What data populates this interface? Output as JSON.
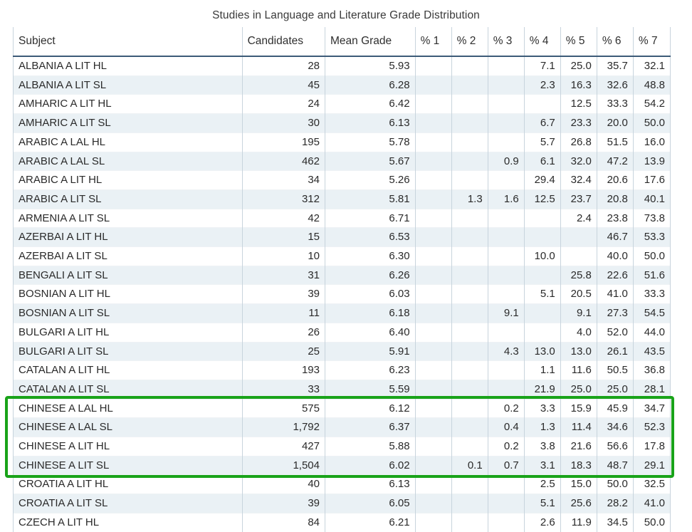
{
  "title": "Studies in Language and Literature Grade Distribution",
  "table": {
    "columns": [
      {
        "key": "subject",
        "label": "Subject"
      },
      {
        "key": "candidates",
        "label": "Candidates"
      },
      {
        "key": "mean_grade",
        "label": "Mean Grade"
      },
      {
        "key": "pct1",
        "label": "% 1"
      },
      {
        "key": "pct2",
        "label": "% 2"
      },
      {
        "key": "pct3",
        "label": "% 3"
      },
      {
        "key": "pct4",
        "label": "% 4"
      },
      {
        "key": "pct5",
        "label": "% 5"
      },
      {
        "key": "pct6",
        "label": "% 6"
      },
      {
        "key": "pct7",
        "label": "% 7"
      }
    ],
    "rows": [
      {
        "subject": "ALBANIA A LIT HL",
        "candidates": "28",
        "mean_grade": "5.93",
        "pct1": "",
        "pct2": "",
        "pct3": "",
        "pct4": "7.1",
        "pct5": "25.0",
        "pct6": "35.7",
        "pct7": "32.1"
      },
      {
        "subject": "ALBANIA A LIT SL",
        "candidates": "45",
        "mean_grade": "6.28",
        "pct1": "",
        "pct2": "",
        "pct3": "",
        "pct4": "2.3",
        "pct5": "16.3",
        "pct6": "32.6",
        "pct7": "48.8"
      },
      {
        "subject": "AMHARIC A LIT HL",
        "candidates": "24",
        "mean_grade": "6.42",
        "pct1": "",
        "pct2": "",
        "pct3": "",
        "pct4": "",
        "pct5": "12.5",
        "pct6": "33.3",
        "pct7": "54.2"
      },
      {
        "subject": "AMHARIC A LIT SL",
        "candidates": "30",
        "mean_grade": "6.13",
        "pct1": "",
        "pct2": "",
        "pct3": "",
        "pct4": "6.7",
        "pct5": "23.3",
        "pct6": "20.0",
        "pct7": "50.0"
      },
      {
        "subject": "ARABIC A LAL HL",
        "candidates": "195",
        "mean_grade": "5.78",
        "pct1": "",
        "pct2": "",
        "pct3": "",
        "pct4": "5.7",
        "pct5": "26.8",
        "pct6": "51.5",
        "pct7": "16.0"
      },
      {
        "subject": "ARABIC A LAL SL",
        "candidates": "462",
        "mean_grade": "5.67",
        "pct1": "",
        "pct2": "",
        "pct3": "0.9",
        "pct4": "6.1",
        "pct5": "32.0",
        "pct6": "47.2",
        "pct7": "13.9"
      },
      {
        "subject": "ARABIC A LIT HL",
        "candidates": "34",
        "mean_grade": "5.26",
        "pct1": "",
        "pct2": "",
        "pct3": "",
        "pct4": "29.4",
        "pct5": "32.4",
        "pct6": "20.6",
        "pct7": "17.6"
      },
      {
        "subject": "ARABIC A LIT SL",
        "candidates": "312",
        "mean_grade": "5.81",
        "pct1": "",
        "pct2": "1.3",
        "pct3": "1.6",
        "pct4": "12.5",
        "pct5": "23.7",
        "pct6": "20.8",
        "pct7": "40.1"
      },
      {
        "subject": "ARMENIA A LIT SL",
        "candidates": "42",
        "mean_grade": "6.71",
        "pct1": "",
        "pct2": "",
        "pct3": "",
        "pct4": "",
        "pct5": "2.4",
        "pct6": "23.8",
        "pct7": "73.8"
      },
      {
        "subject": "AZERBAI A LIT HL",
        "candidates": "15",
        "mean_grade": "6.53",
        "pct1": "",
        "pct2": "",
        "pct3": "",
        "pct4": "",
        "pct5": "",
        "pct6": "46.7",
        "pct7": "53.3"
      },
      {
        "subject": "AZERBAI A LIT SL",
        "candidates": "10",
        "mean_grade": "6.30",
        "pct1": "",
        "pct2": "",
        "pct3": "",
        "pct4": "10.0",
        "pct5": "",
        "pct6": "40.0",
        "pct7": "50.0"
      },
      {
        "subject": "BENGALI A LIT SL",
        "candidates": "31",
        "mean_grade": "6.26",
        "pct1": "",
        "pct2": "",
        "pct3": "",
        "pct4": "",
        "pct5": "25.8",
        "pct6": "22.6",
        "pct7": "51.6"
      },
      {
        "subject": "BOSNIAN A LIT HL",
        "candidates": "39",
        "mean_grade": "6.03",
        "pct1": "",
        "pct2": "",
        "pct3": "",
        "pct4": "5.1",
        "pct5": "20.5",
        "pct6": "41.0",
        "pct7": "33.3"
      },
      {
        "subject": "BOSNIAN A LIT SL",
        "candidates": "11",
        "mean_grade": "6.18",
        "pct1": "",
        "pct2": "",
        "pct3": "9.1",
        "pct4": "",
        "pct5": "9.1",
        "pct6": "27.3",
        "pct7": "54.5"
      },
      {
        "subject": "BULGARI A LIT HL",
        "candidates": "26",
        "mean_grade": "6.40",
        "pct1": "",
        "pct2": "",
        "pct3": "",
        "pct4": "",
        "pct5": "4.0",
        "pct6": "52.0",
        "pct7": "44.0"
      },
      {
        "subject": "BULGARI A LIT SL",
        "candidates": "25",
        "mean_grade": "5.91",
        "pct1": "",
        "pct2": "",
        "pct3": "4.3",
        "pct4": "13.0",
        "pct5": "13.0",
        "pct6": "26.1",
        "pct7": "43.5"
      },
      {
        "subject": "CATALAN A LIT HL",
        "candidates": "193",
        "mean_grade": "6.23",
        "pct1": "",
        "pct2": "",
        "pct3": "",
        "pct4": "1.1",
        "pct5": "11.6",
        "pct6": "50.5",
        "pct7": "36.8"
      },
      {
        "subject": "CATALAN A LIT SL",
        "candidates": "33",
        "mean_grade": "5.59",
        "pct1": "",
        "pct2": "",
        "pct3": "",
        "pct4": "21.9",
        "pct5": "25.0",
        "pct6": "25.0",
        "pct7": "28.1"
      },
      {
        "subject": "CHINESE A LAL HL",
        "candidates": "575",
        "mean_grade": "6.12",
        "pct1": "",
        "pct2": "",
        "pct3": "0.2",
        "pct4": "3.3",
        "pct5": "15.9",
        "pct6": "45.9",
        "pct7": "34.7"
      },
      {
        "subject": "CHINESE A LAL SL",
        "candidates": "1,792",
        "mean_grade": "6.37",
        "pct1": "",
        "pct2": "",
        "pct3": "0.4",
        "pct4": "1.3",
        "pct5": "11.4",
        "pct6": "34.6",
        "pct7": "52.3"
      },
      {
        "subject": "CHINESE A LIT HL",
        "candidates": "427",
        "mean_grade": "5.88",
        "pct1": "",
        "pct2": "",
        "pct3": "0.2",
        "pct4": "3.8",
        "pct5": "21.6",
        "pct6": "56.6",
        "pct7": "17.8"
      },
      {
        "subject": "CHINESE A LIT SL",
        "candidates": "1,504",
        "mean_grade": "6.02",
        "pct1": "",
        "pct2": "0.1",
        "pct3": "0.7",
        "pct4": "3.1",
        "pct5": "18.3",
        "pct6": "48.7",
        "pct7": "29.1"
      },
      {
        "subject": "CROATIA A LIT HL",
        "candidates": "40",
        "mean_grade": "6.13",
        "pct1": "",
        "pct2": "",
        "pct3": "",
        "pct4": "2.5",
        "pct5": "15.0",
        "pct6": "50.0",
        "pct7": "32.5"
      },
      {
        "subject": "CROATIA A LIT SL",
        "candidates": "39",
        "mean_grade": "6.05",
        "pct1": "",
        "pct2": "",
        "pct3": "",
        "pct4": "5.1",
        "pct5": "25.6",
        "pct6": "28.2",
        "pct7": "41.0"
      },
      {
        "subject": "CZECH A LIT HL",
        "candidates": "84",
        "mean_grade": "6.21",
        "pct1": "",
        "pct2": "",
        "pct3": "",
        "pct4": "2.6",
        "pct5": "11.9",
        "pct6": "34.5",
        "pct7": "50.0"
      }
    ]
  },
  "highlight": {
    "color": "#19a319",
    "first_row_index": 18,
    "last_row_index": 21
  }
}
